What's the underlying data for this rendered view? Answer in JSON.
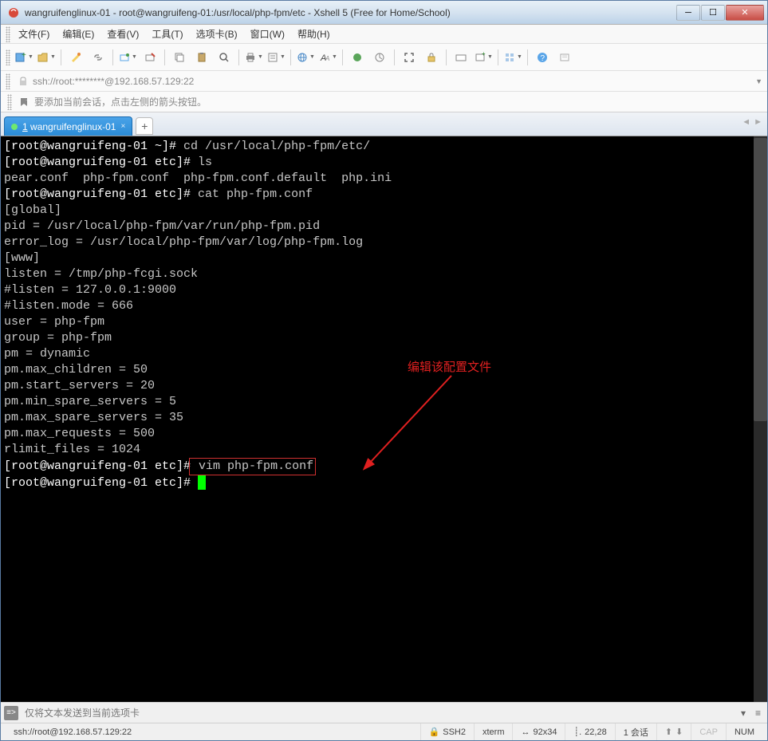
{
  "window": {
    "title": "wangruifenglinux-01 - root@wangruifeng-01:/usr/local/php-fpm/etc - Xshell 5 (Free for Home/School)"
  },
  "menu": {
    "file": "文件(F)",
    "edit": "编辑(E)",
    "view": "查看(V)",
    "tools": "工具(T)",
    "tabs": "选项卡(B)",
    "window": "窗口(W)",
    "help": "帮助(H)"
  },
  "address": {
    "value": "ssh://root:********@192.168.57.129:22"
  },
  "hint": {
    "text": "要添加当前会话，点击左侧的箭头按钮。"
  },
  "tab": {
    "index": "1",
    "label": "wangruifenglinux-01"
  },
  "terminal": {
    "line1_prompt": "[root@wangruifeng-01 ~]#",
    "line1_cmd": " cd /usr/local/php-fpm/etc/",
    "line2_prompt": "[root@wangruifeng-01 etc]#",
    "line2_cmd": " ls",
    "line3": "pear.conf  php-fpm.conf  php-fpm.conf.default  php.ini",
    "line4_prompt": "[root@wangruifeng-01 etc]#",
    "line4_cmd": " cat php-fpm.conf",
    "line5": "[global]",
    "line6": "pid = /usr/local/php-fpm/var/run/php-fpm.pid",
    "line7": "error_log = /usr/local/php-fpm/var/log/php-fpm.log",
    "line8": "[www]",
    "line9": "listen = /tmp/php-fcgi.sock",
    "line10": "#listen = 127.0.0.1:9000",
    "line11": "#listen.mode = 666",
    "line12": "user = php-fpm",
    "line13": "group = php-fpm",
    "line14": "pm = dynamic",
    "line15": "pm.max_children = 50",
    "line16": "pm.start_servers = 20",
    "line17": "pm.min_spare_servers = 5",
    "line18": "pm.max_spare_servers = 35",
    "line19": "pm.max_requests = 500",
    "line20": "rlimit_files = 1024",
    "line21_prompt": "[root@wangruifeng-01 etc]#",
    "line21_cmd": " vim php-fpm.conf",
    "line22_prompt": "[root@wangruifeng-01 etc]#",
    "annotation": "编辑该配置文件"
  },
  "sendbar": {
    "placeholder": "仅将文本发送到当前选项卡"
  },
  "status": {
    "path": "ssh://root@192.168.57.129:22",
    "proto": "SSH2",
    "term": "xterm",
    "size": "92x34",
    "pos": "22,28",
    "sessions": "1 会话",
    "cap": "CAP",
    "num": "NUM"
  }
}
